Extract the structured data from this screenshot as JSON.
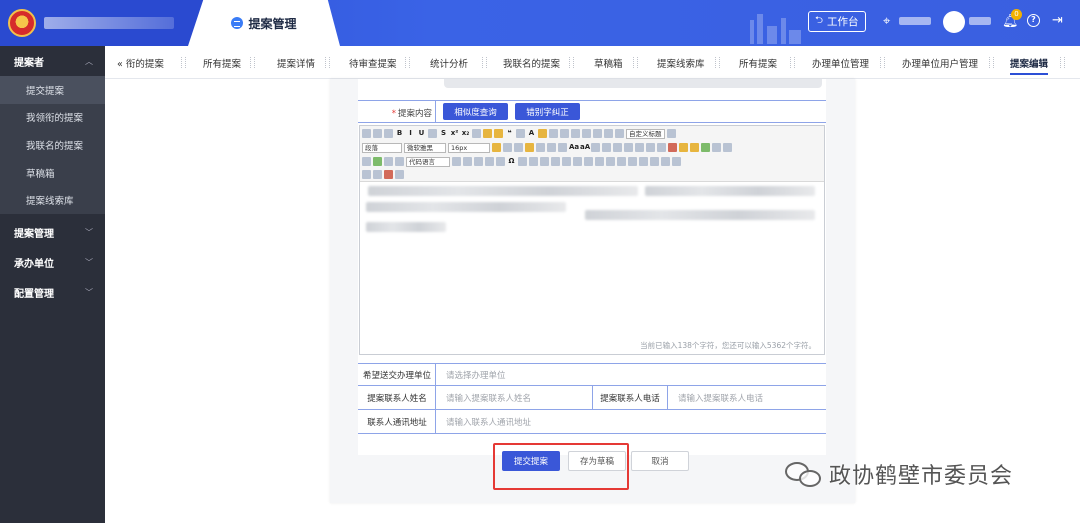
{
  "header": {
    "module_title": "提案管理",
    "workbench_label": "工作台",
    "notification_count": "0"
  },
  "sidebar": {
    "groups": [
      {
        "label": "提案者",
        "expanded": true,
        "items": [
          "提交提案",
          "我领衔的提案",
          "我联名的提案",
          "草稿箱",
          "提案线索库"
        ]
      },
      {
        "label": "提案管理"
      },
      {
        "label": "承办单位"
      },
      {
        "label": "配置管理"
      }
    ]
  },
  "tabs": [
    {
      "label": "« 衔的提案"
    },
    {
      "label": "所有提案"
    },
    {
      "label": "提案详情"
    },
    {
      "label": "待审查提案"
    },
    {
      "label": "统计分析"
    },
    {
      "label": "我联名的提案"
    },
    {
      "label": "草稿箱"
    },
    {
      "label": "提案线索库"
    },
    {
      "label": "所有提案"
    },
    {
      "label": "办理单位管理"
    },
    {
      "label": "办理单位用户管理"
    },
    {
      "label": "提案编辑",
      "active": true
    }
  ],
  "form": {
    "content_label": "提案内容",
    "similarity_button": "相似度查询",
    "typo_button": "错别字纠正",
    "editor": {
      "para_select": "段落",
      "font_select": "微软雅黑",
      "size_select": "16px",
      "custom_title_select": "自定义标题",
      "code_select": "代码语言",
      "counter_text": "当前已输入138个字符，您还可以输入5362个字符。"
    },
    "unit_label": "希望送交办理单位",
    "unit_placeholder": "请选择办理单位",
    "contact_name_label": "提案联系人姓名",
    "contact_name_placeholder": "请输入提案联系人姓名",
    "contact_phone_label": "提案联系人电话",
    "contact_phone_placeholder": "请输入提案联系人电话",
    "address_label": "联系人通讯地址",
    "address_placeholder": "请输入联系人通讯地址"
  },
  "actions": {
    "submit": "提交提案",
    "save_draft": "存为草稿",
    "cancel": "取消"
  },
  "watermark": {
    "text": "政协鹤壁市委员会"
  },
  "colors": {
    "primary": "#3a57d8",
    "header": "#2c4fd6",
    "sidebar": "#2b2f3a",
    "highlight": "#e53935"
  }
}
